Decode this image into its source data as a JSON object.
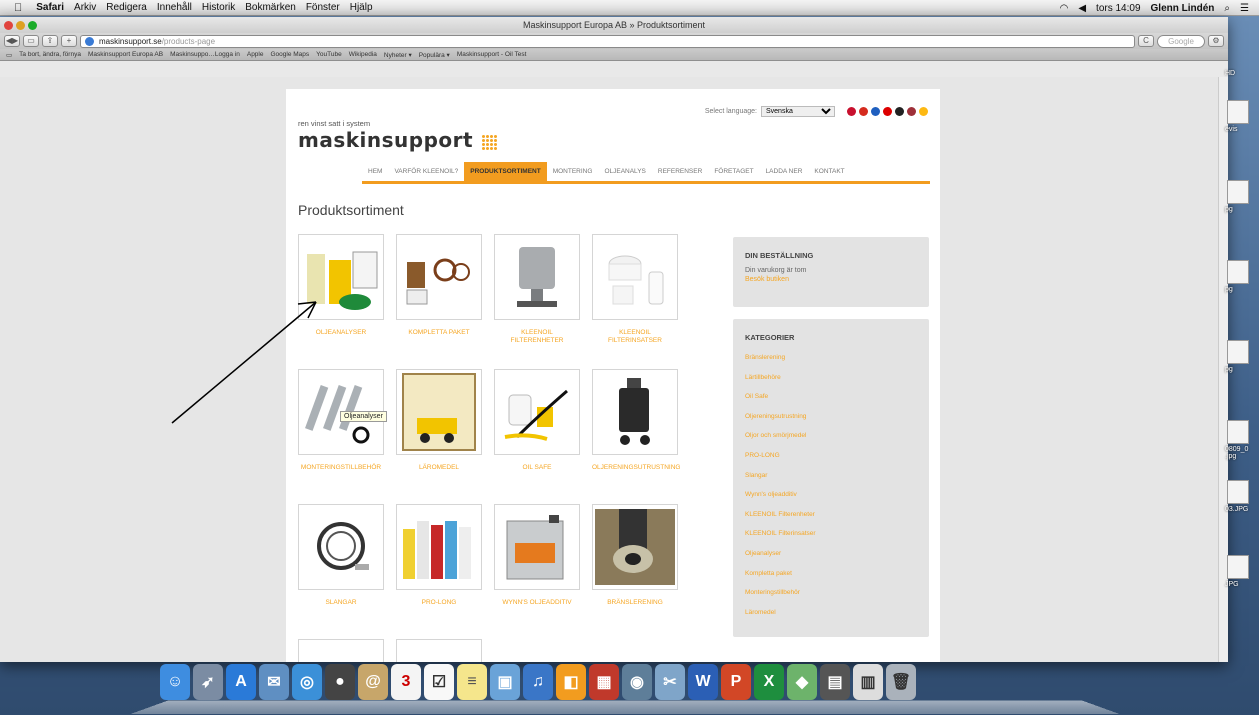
{
  "menubar": {
    "app": "Safari",
    "items": [
      "Arkiv",
      "Redigera",
      "Innehåll",
      "Historik",
      "Bokmärken",
      "Fönster",
      "Hjälp"
    ],
    "clock": "tors 14:09",
    "user": "Glenn Lindén"
  },
  "window": {
    "title": "Maskinsupport Europa AB » Produktsortiment"
  },
  "url": {
    "host": "maskinsupport.se",
    "path": "/products-page"
  },
  "search_placeholder": "Google",
  "bookmarks": [
    "Ta bort, ändra, förnya",
    "Maskinsupport Europa AB",
    "Maskinsuppo…Logga in",
    "Apple",
    "Google Maps",
    "YouTube",
    "Wikipedia",
    "Nyheter ▾",
    "Populära ▾",
    "Maskinsupport - Oil Test"
  ],
  "site": {
    "language_label": "Select language:",
    "language_value": "Svenska",
    "tagline": "ren vinst satt i system",
    "logo": "maskinsupport",
    "nav": [
      "HEM",
      "VARFÖR KLEENOIL?",
      "PRODUKTSORTIMENT",
      "MONTERING",
      "OLJEANALYS",
      "REFERENSER",
      "FÖRETAGET",
      "LADDA NER",
      "KONTAKT"
    ],
    "heading": "Produktsortiment",
    "products": [
      {
        "label": "OLJEANALYSER"
      },
      {
        "label": "KOMPLETTA PAKET"
      },
      {
        "label": "KLEENOIL FILTERENHETER"
      },
      {
        "label": "KLEENOIL FILTERINSATSER"
      },
      {
        "label": "MONTERINGSTILLBEHÖR"
      },
      {
        "label": "LÄROMEDEL"
      },
      {
        "label": "OIL SAFE"
      },
      {
        "label": "OLJERENINGSUTRUSTNING"
      },
      {
        "label": "SLANGAR"
      },
      {
        "label": "PRO-LONG"
      },
      {
        "label": "WYNN'S OLJEADDITIV"
      },
      {
        "label": "BRÄNSLERENING"
      }
    ],
    "tooltip": "Oljeanalyser",
    "cart": {
      "title": "DIN BESTÄLLNING",
      "empty": "Din varukorg är tom",
      "link": "Besök butiken"
    },
    "categories": {
      "title": "KATEGORIER",
      "items": [
        "Bränslerening",
        "Lärtillbehöre",
        "Oil Safe",
        "Oljereningsutrustning",
        "Oljor och smörjmedel",
        "PRO-LONG",
        "Slangar",
        "Wynn's oljeadditiv",
        "KLEENOIL Filterenheter",
        "KLEENOIL Filterinsatser",
        "Oljeanalyser",
        "Kompletta paket",
        "Monteringstillbehör",
        "Läromedel"
      ]
    }
  },
  "desktop_files": [
    "HD",
    "evis",
    "pg",
    "pg",
    "pg",
    "0809_0 .jpg",
    "03.JPG",
    "JPG"
  ],
  "colors": {
    "accent": "#f29c1f",
    "link": "#f5a623"
  }
}
